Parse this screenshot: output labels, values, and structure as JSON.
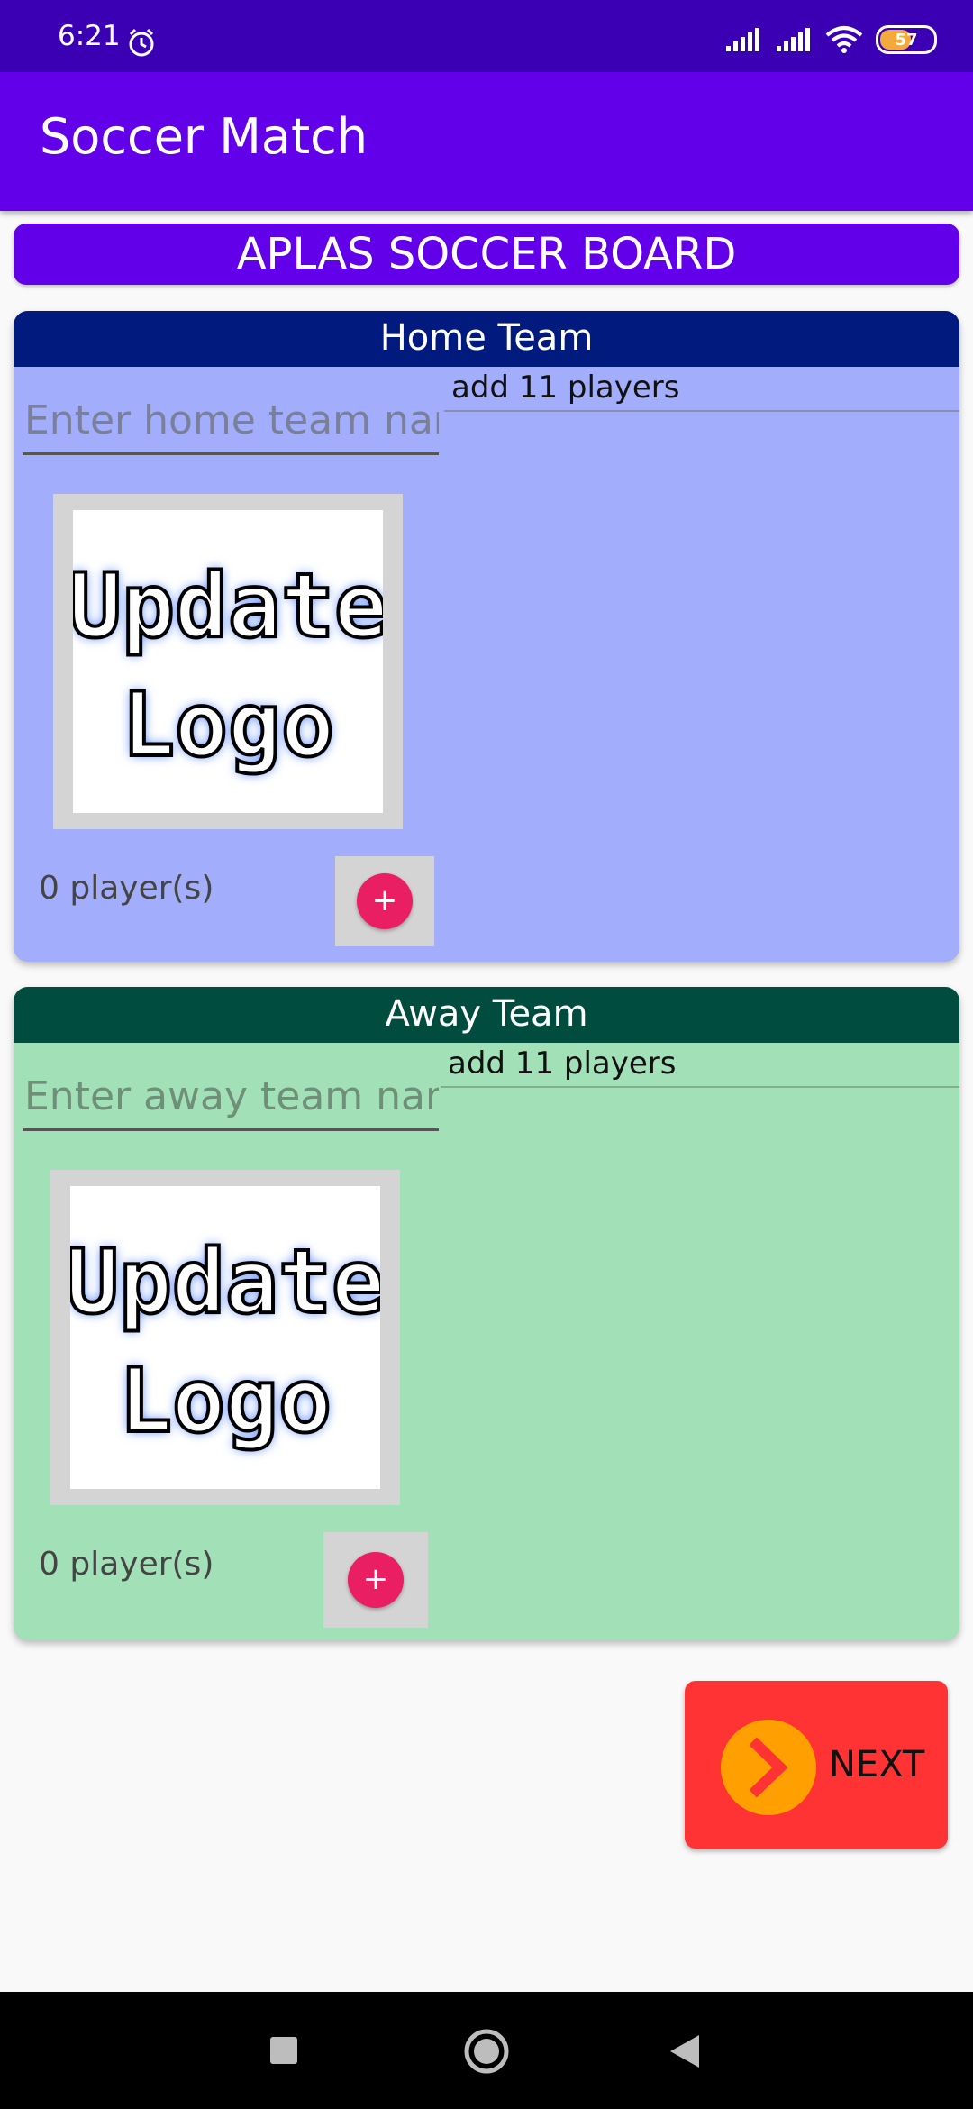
{
  "status": {
    "time": "6:21",
    "battery": "57",
    "icons": [
      "alarm-icon",
      "signal-icon",
      "signal-icon",
      "wifi-icon",
      "battery-icon"
    ]
  },
  "appbar": {
    "title": "Soccer Match"
  },
  "board": {
    "title": "APLAS SOCCER BOARD"
  },
  "home": {
    "header": "Home Team",
    "name_placeholder": "Enter home team name",
    "players_hint": "add 11 players",
    "logo_text": [
      "Update",
      "Logo"
    ],
    "player_count": "0 player(s)",
    "add_label": "+"
  },
  "away": {
    "header": "Away Team",
    "name_placeholder": "Enter away team name",
    "players_hint": "add 11 players",
    "logo_text": [
      "Update",
      "Logo"
    ],
    "player_count": "0 player(s)",
    "add_label": "+"
  },
  "next": {
    "label": "NEXT"
  },
  "colors": {
    "status_bar": "#3c00b4",
    "app_bar": "#6200ea",
    "home_header": "#011a7e",
    "home_body": "#a2aefc",
    "away_header": "#004c3f",
    "away_body": "#a2e1b8",
    "add_button": "#e91e63",
    "next_button": "#ff3333",
    "next_circle": "#ff9f00"
  }
}
